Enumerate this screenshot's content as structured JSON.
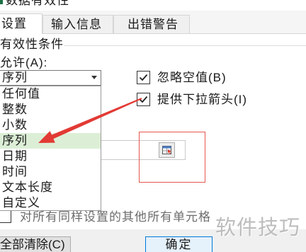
{
  "window": {
    "title": "数据有效性"
  },
  "tabs": [
    {
      "label": "设置",
      "active": true
    },
    {
      "label": "输入信息",
      "active": false
    },
    {
      "label": "出错警告",
      "active": false
    }
  ],
  "settings": {
    "group_title": "有效性条件",
    "allow_label": "允许(A):",
    "allow_value": "序列",
    "allow_options": [
      {
        "label": "任何值",
        "highlighted": false
      },
      {
        "label": "整数",
        "highlighted": false
      },
      {
        "label": "小数",
        "highlighted": false
      },
      {
        "label": "序列",
        "highlighted": true
      },
      {
        "label": "日期",
        "highlighted": false
      },
      {
        "label": "时间",
        "highlighted": false
      },
      {
        "label": "文本长度",
        "highlighted": false
      },
      {
        "label": "自定义",
        "highlighted": false
      }
    ],
    "ignore_blank": {
      "label": "忽略空值(B)",
      "checked": true
    },
    "in_cell_dropdown": {
      "label": "提供下拉箭头(I)",
      "checked": true
    },
    "apply_to_all": {
      "label": "对所有同样设置的其他所有单元格",
      "checked": false
    }
  },
  "buttons": {
    "clear_all": "全部清除(C)",
    "ok": "确定"
  },
  "watermark": "软件技巧",
  "colors": {
    "annotation_red": "#e4574f",
    "highlight_row": "#dcefd6",
    "default_button_border": "#0078d7",
    "app_icon_green": "#1e7145"
  },
  "icons": {
    "dropdown": "chevron-down-icon",
    "range_select": "range-select-icon",
    "check": "check-icon"
  }
}
